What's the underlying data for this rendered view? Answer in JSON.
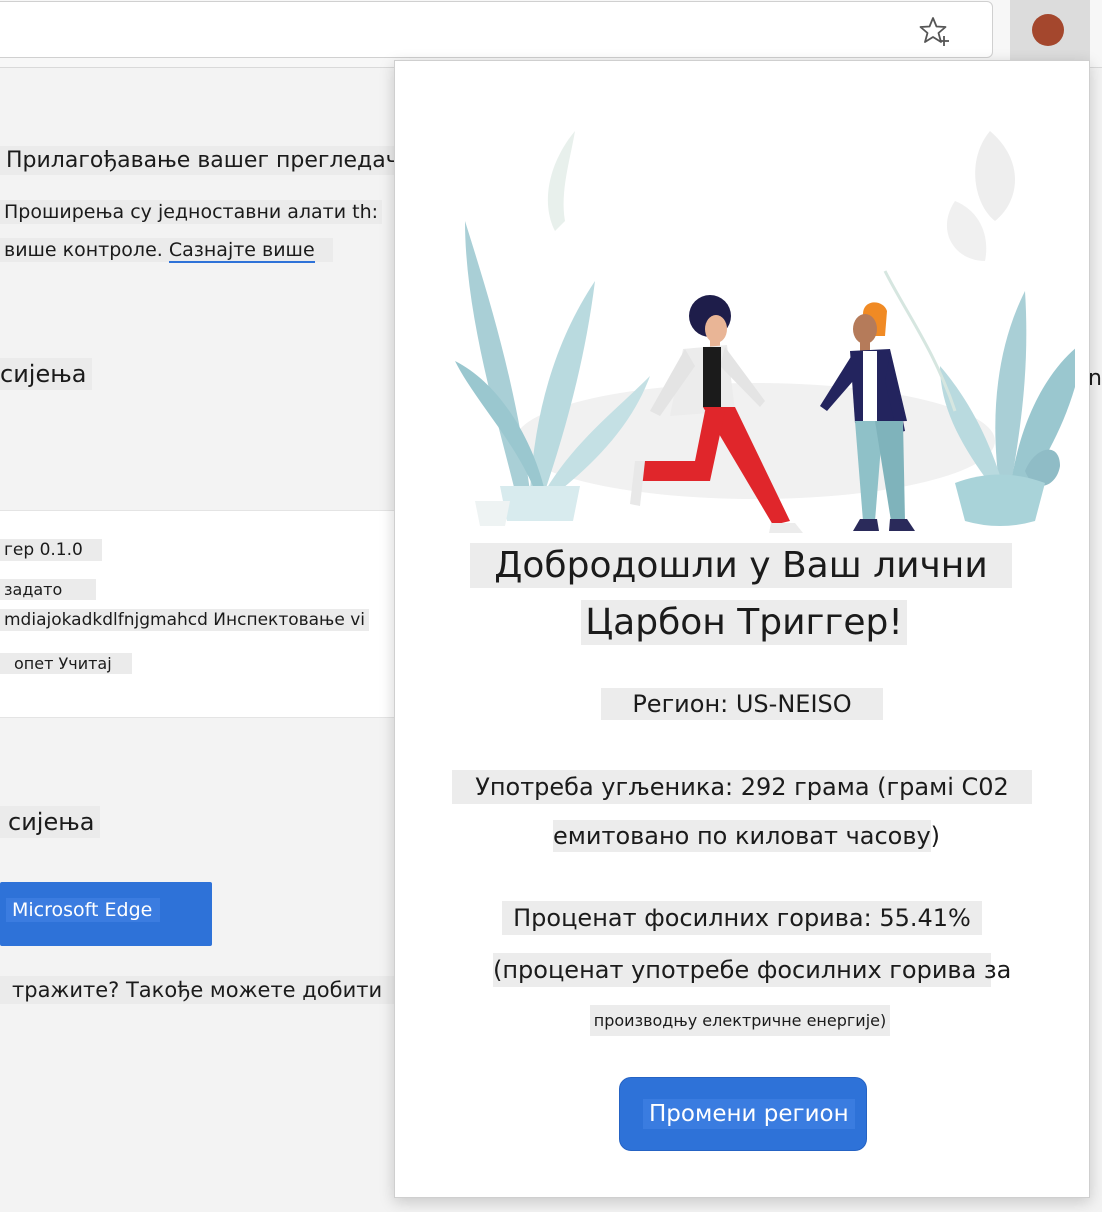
{
  "toolbar": {
    "favorites_icon": "star-add-icon",
    "extension_icon_color": "#a4472d"
  },
  "background_page": {
    "heading": "Прилагођавање вашег прегледача",
    "intro_line1": "Проширења су једноставни алати th:",
    "intro_line2": "више контроле.",
    "learn_more": "Сазнајте више",
    "section_heading": "сијења",
    "card": {
      "name_version": "гер 0.1.0",
      "default_label": "задато",
      "id_line": "mdiajokadkdlfnjgmahcd Инспектовање vi",
      "reload_label": "опет Учитај"
    },
    "section_heading_2": "сијења",
    "edge_button": "Microsoft Edge",
    "find_more": "тражите? Такође можете добити",
    "right_edge_char": "n"
  },
  "popup": {
    "title_line1": "Добродошли у Ваш лични",
    "title_line2": "Царбон Триггер!",
    "region": "Регион: US-NEISO",
    "carbon_usage_line1": "Употреба угљеника: 292 грама (грамі C02",
    "carbon_usage_line2": "емитовано по киловат часову)",
    "fossil_line1": "Проценат фосилних горива: 55.41%",
    "fossil_line2": "(проценат употребе фосилних горива за",
    "fossil_line3": "производњу електричне енергије)",
    "change_region_button": "Промени регион",
    "colors": {
      "button": "#2e72d8",
      "plant": "#9fcfd6",
      "pants_red": "#e0262b"
    }
  }
}
